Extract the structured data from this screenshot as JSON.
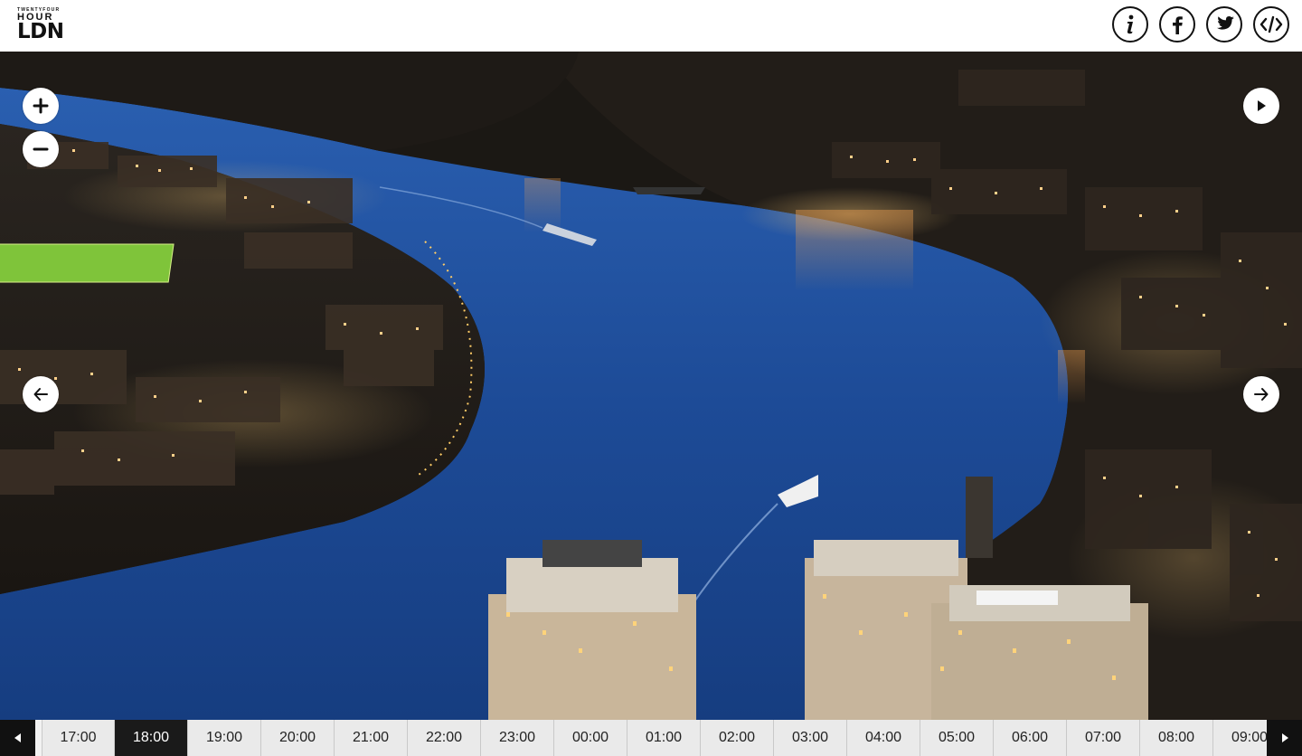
{
  "brand": {
    "small_text": "TWENTYFOUR",
    "hour_text": "HOUR",
    "city_text": "LDN"
  },
  "header_actions": [
    {
      "name": "info-button",
      "icon": "info-icon"
    },
    {
      "name": "facebook-button",
      "icon": "facebook-icon"
    },
    {
      "name": "twitter-button",
      "icon": "twitter-icon"
    },
    {
      "name": "embed-button",
      "icon": "code-icon"
    }
  ],
  "viewer_controls": {
    "zoom_in_icon": "plus-icon",
    "zoom_out_icon": "minus-icon",
    "play_icon": "play-icon",
    "prev_icon": "arrow-left-icon",
    "next_icon": "arrow-right-icon"
  },
  "timeline": {
    "selected": "18:00",
    "times": [
      "17:00",
      "18:00",
      "19:00",
      "20:00",
      "21:00",
      "22:00",
      "23:00",
      "00:00",
      "01:00",
      "02:00",
      "03:00",
      "04:00",
      "05:00",
      "06:00",
      "07:00",
      "08:00",
      "09:00"
    ],
    "prev_icon": "caret-left-icon",
    "next_icon": "caret-right-icon"
  },
  "colors": {
    "header_bg": "#ffffff",
    "active_time_bg": "#1a1a1a",
    "timeline_bg": "#eaeaea",
    "river": "#1f4f9a",
    "night_sky": "#0d1a33"
  }
}
